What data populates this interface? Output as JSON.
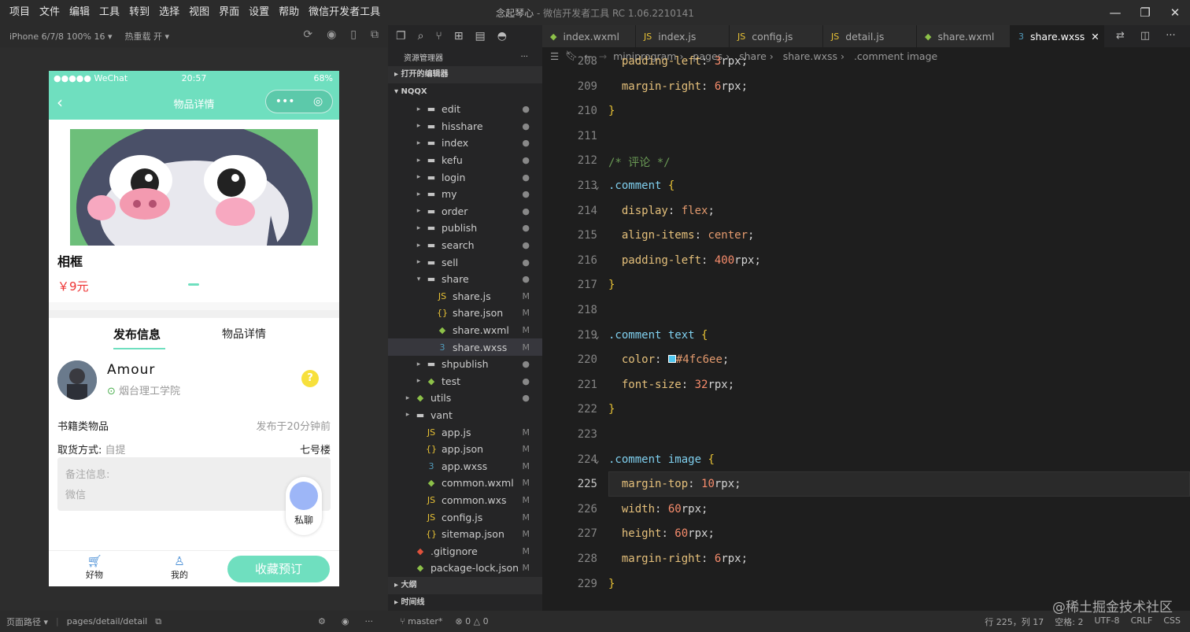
{
  "window": {
    "title_main": "念起琴心",
    "title_sep": " - ",
    "title_app": "微信开发者工具 RC 1.06.2210141"
  },
  "menu": [
    "项目",
    "文件",
    "编辑",
    "工具",
    "转到",
    "选择",
    "视图",
    "界面",
    "设置",
    "帮助",
    "微信开发者工具"
  ],
  "simulator": {
    "device": "iPhone 6/7/8 100% 16 ▾",
    "hot_reload": "热重载 开 ▾",
    "status": {
      "carrier": "●●●●● WeChat",
      "time": "20:57",
      "battery": "68%"
    },
    "nav_title": "物品详情",
    "product": {
      "name": "相框",
      "price": "￥9元"
    },
    "tabs": [
      "发布信息",
      "物品详情"
    ],
    "user": {
      "name": "Amour",
      "school": "烟台理工学院"
    },
    "category": "书籍类物品",
    "posted": "发布于20分钟前",
    "pickup_label": "取货方式:",
    "pickup_value": "自提",
    "location": "七号楼",
    "remark_label": "备注信息:",
    "remark_value": "微信",
    "chat_label": "私聊",
    "tabbar": {
      "home": "好物",
      "mine": "我的",
      "action": "收藏预订"
    }
  },
  "explorer": {
    "header": "资源管理器",
    "open_editors": "打开的编辑器",
    "project": "NQQX",
    "outline": "大纲",
    "timeline": "时间线",
    "items": [
      {
        "arr": "▸",
        "type": "fold",
        "name": "edit",
        "status": "●",
        "indent": 2
      },
      {
        "arr": "▸",
        "type": "fold",
        "name": "hisshare",
        "status": "●",
        "indent": 2
      },
      {
        "arr": "▸",
        "type": "fold",
        "name": "index",
        "status": "●",
        "indent": 2
      },
      {
        "arr": "▸",
        "type": "fold",
        "name": "kefu",
        "status": "●",
        "indent": 2
      },
      {
        "arr": "▸",
        "type": "fold",
        "name": "login",
        "status": "●",
        "indent": 2
      },
      {
        "arr": "▸",
        "type": "fold",
        "name": "my",
        "status": "●",
        "indent": 2
      },
      {
        "arr": "▸",
        "type": "fold",
        "name": "order",
        "status": "●",
        "indent": 2
      },
      {
        "arr": "▸",
        "type": "fold",
        "name": "publish",
        "status": "●",
        "indent": 2
      },
      {
        "arr": "▸",
        "type": "fold",
        "name": "search",
        "status": "●",
        "indent": 2
      },
      {
        "arr": "▸",
        "type": "fold",
        "name": "sell",
        "status": "●",
        "indent": 2
      },
      {
        "arr": "▾",
        "type": "fold",
        "name": "share",
        "status": "●",
        "indent": 2
      },
      {
        "arr": "",
        "type": "js",
        "name": "share.js",
        "status": "M",
        "indent": 3
      },
      {
        "arr": "",
        "type": "jn",
        "name": "share.json",
        "status": "M",
        "indent": 3
      },
      {
        "arr": "",
        "type": "wx",
        "name": "share.wxml",
        "status": "M",
        "indent": 3
      },
      {
        "arr": "",
        "type": "css",
        "name": "share.wxss",
        "status": "M",
        "indent": 3,
        "selected": true
      },
      {
        "arr": "▸",
        "type": "fold",
        "name": "shpublish",
        "status": "●",
        "indent": 2
      },
      {
        "arr": "▸",
        "type": "wx",
        "name": "test",
        "status": "●",
        "indent": 2
      },
      {
        "arr": "▸",
        "type": "wx",
        "name": "utils",
        "status": "●",
        "indent": 1
      },
      {
        "arr": "▸",
        "type": "fold",
        "name": "vant",
        "status": "",
        "indent": 1
      },
      {
        "arr": "",
        "type": "js",
        "name": "app.js",
        "status": "M",
        "indent": 2
      },
      {
        "arr": "",
        "type": "jn",
        "name": "app.json",
        "status": "M",
        "indent": 2
      },
      {
        "arr": "",
        "type": "css",
        "name": "app.wxss",
        "status": "M",
        "indent": 2
      },
      {
        "arr": "",
        "type": "wx",
        "name": "common.wxml",
        "status": "M",
        "indent": 2
      },
      {
        "arr": "",
        "type": "js",
        "name": "common.wxs",
        "status": "M",
        "indent": 2
      },
      {
        "arr": "",
        "type": "js",
        "name": "config.js",
        "status": "M",
        "indent": 2
      },
      {
        "arr": "",
        "type": "jn",
        "name": "sitemap.json",
        "status": "M",
        "indent": 2
      },
      {
        "arr": "",
        "type": "git",
        "name": ".gitignore",
        "status": "M",
        "indent": 1
      },
      {
        "arr": "",
        "type": "wx",
        "name": "package-lock.json",
        "status": "M",
        "indent": 1
      }
    ]
  },
  "tabs": [
    {
      "name": "index.wxml",
      "type": "wx"
    },
    {
      "name": "index.js",
      "type": "js"
    },
    {
      "name": "config.js",
      "type": "js"
    },
    {
      "name": "detail.js",
      "type": "js"
    },
    {
      "name": "share.wxml",
      "type": "wx"
    },
    {
      "name": "share.wxss",
      "type": "css",
      "active": true
    }
  ],
  "breadcrumb": [
    "miniprogram",
    "pages",
    "share",
    "share.wxss",
    ".comment image"
  ],
  "code": [
    {
      "n": "208",
      "h": "  <span class='prop'>padding-left</span>: <span class='num'>3</span>rpx;"
    },
    {
      "n": "209",
      "h": "  <span class='prop'>margin-right</span>: <span class='num'>6</span>rpx;"
    },
    {
      "n": "210",
      "h": "<span class='sel1'>}</span>"
    },
    {
      "n": "211",
      "h": ""
    },
    {
      "n": "212",
      "h": "<span class='cm'>/* 评论 */</span>"
    },
    {
      "n": "213",
      "h": "<span class='cls'>.comment</span> <span class='sel1'>{</span>",
      "fold": true
    },
    {
      "n": "214",
      "h": "  <span class='prop'>display</span>: <span class='val'>flex</span>;"
    },
    {
      "n": "215",
      "h": "  <span class='prop'>align-items</span>: <span class='val'>center</span>;"
    },
    {
      "n": "216",
      "h": "  <span class='prop'>padding-left</span>: <span class='num'>400</span>rpx;"
    },
    {
      "n": "217",
      "h": "<span class='sel1'>}</span>"
    },
    {
      "n": "218",
      "h": ""
    },
    {
      "n": "219",
      "h": "<span class='cls'>.comment</span> <span class='tag'>text</span> <span class='sel1'>{</span>",
      "fold": true
    },
    {
      "n": "220",
      "h": "  <span class='prop'>color</span>: <span style='display:inline-block;width:10px;height:10px;background:#4fc6ee;border:1px solid #fff'></span><span class='val'>#4fc6ee</span>;"
    },
    {
      "n": "221",
      "h": "  <span class='prop'>font-size</span>: <span class='num'>32</span>rpx;"
    },
    {
      "n": "222",
      "h": "<span class='sel1'>}</span>"
    },
    {
      "n": "223",
      "h": ""
    },
    {
      "n": "224",
      "h": "<span class='cls'>.comment</span> <span class='tag'>image</span> <span class='sel1'>{</span>",
      "fold": true
    },
    {
      "n": "225",
      "h": "  <span class='prop'>margin-top</span>: <span class='num'>10</span>rpx;",
      "cur": true
    },
    {
      "n": "226",
      "h": "  <span class='prop'>width</span>: <span class='num'>60</span>rpx;"
    },
    {
      "n": "227",
      "h": "  <span class='prop'>height</span>: <span class='num'>60</span>rpx;"
    },
    {
      "n": "228",
      "h": "  <span class='prop'>margin-right</span>: <span class='num'>6</span>rpx;"
    },
    {
      "n": "229",
      "h": "<span class='sel1'>}</span>"
    }
  ],
  "status": {
    "path_label": "页面路径 ▾",
    "path": "pages/detail/detail",
    "branch": "master*",
    "problems": "⊗ 0 △ 0",
    "position": "行 225，列 17",
    "spaces": "空格: 2",
    "encoding": "UTF-8",
    "eol": "CRLF",
    "lang": "CSS"
  },
  "watermark": "@稀土掘金技术社区"
}
